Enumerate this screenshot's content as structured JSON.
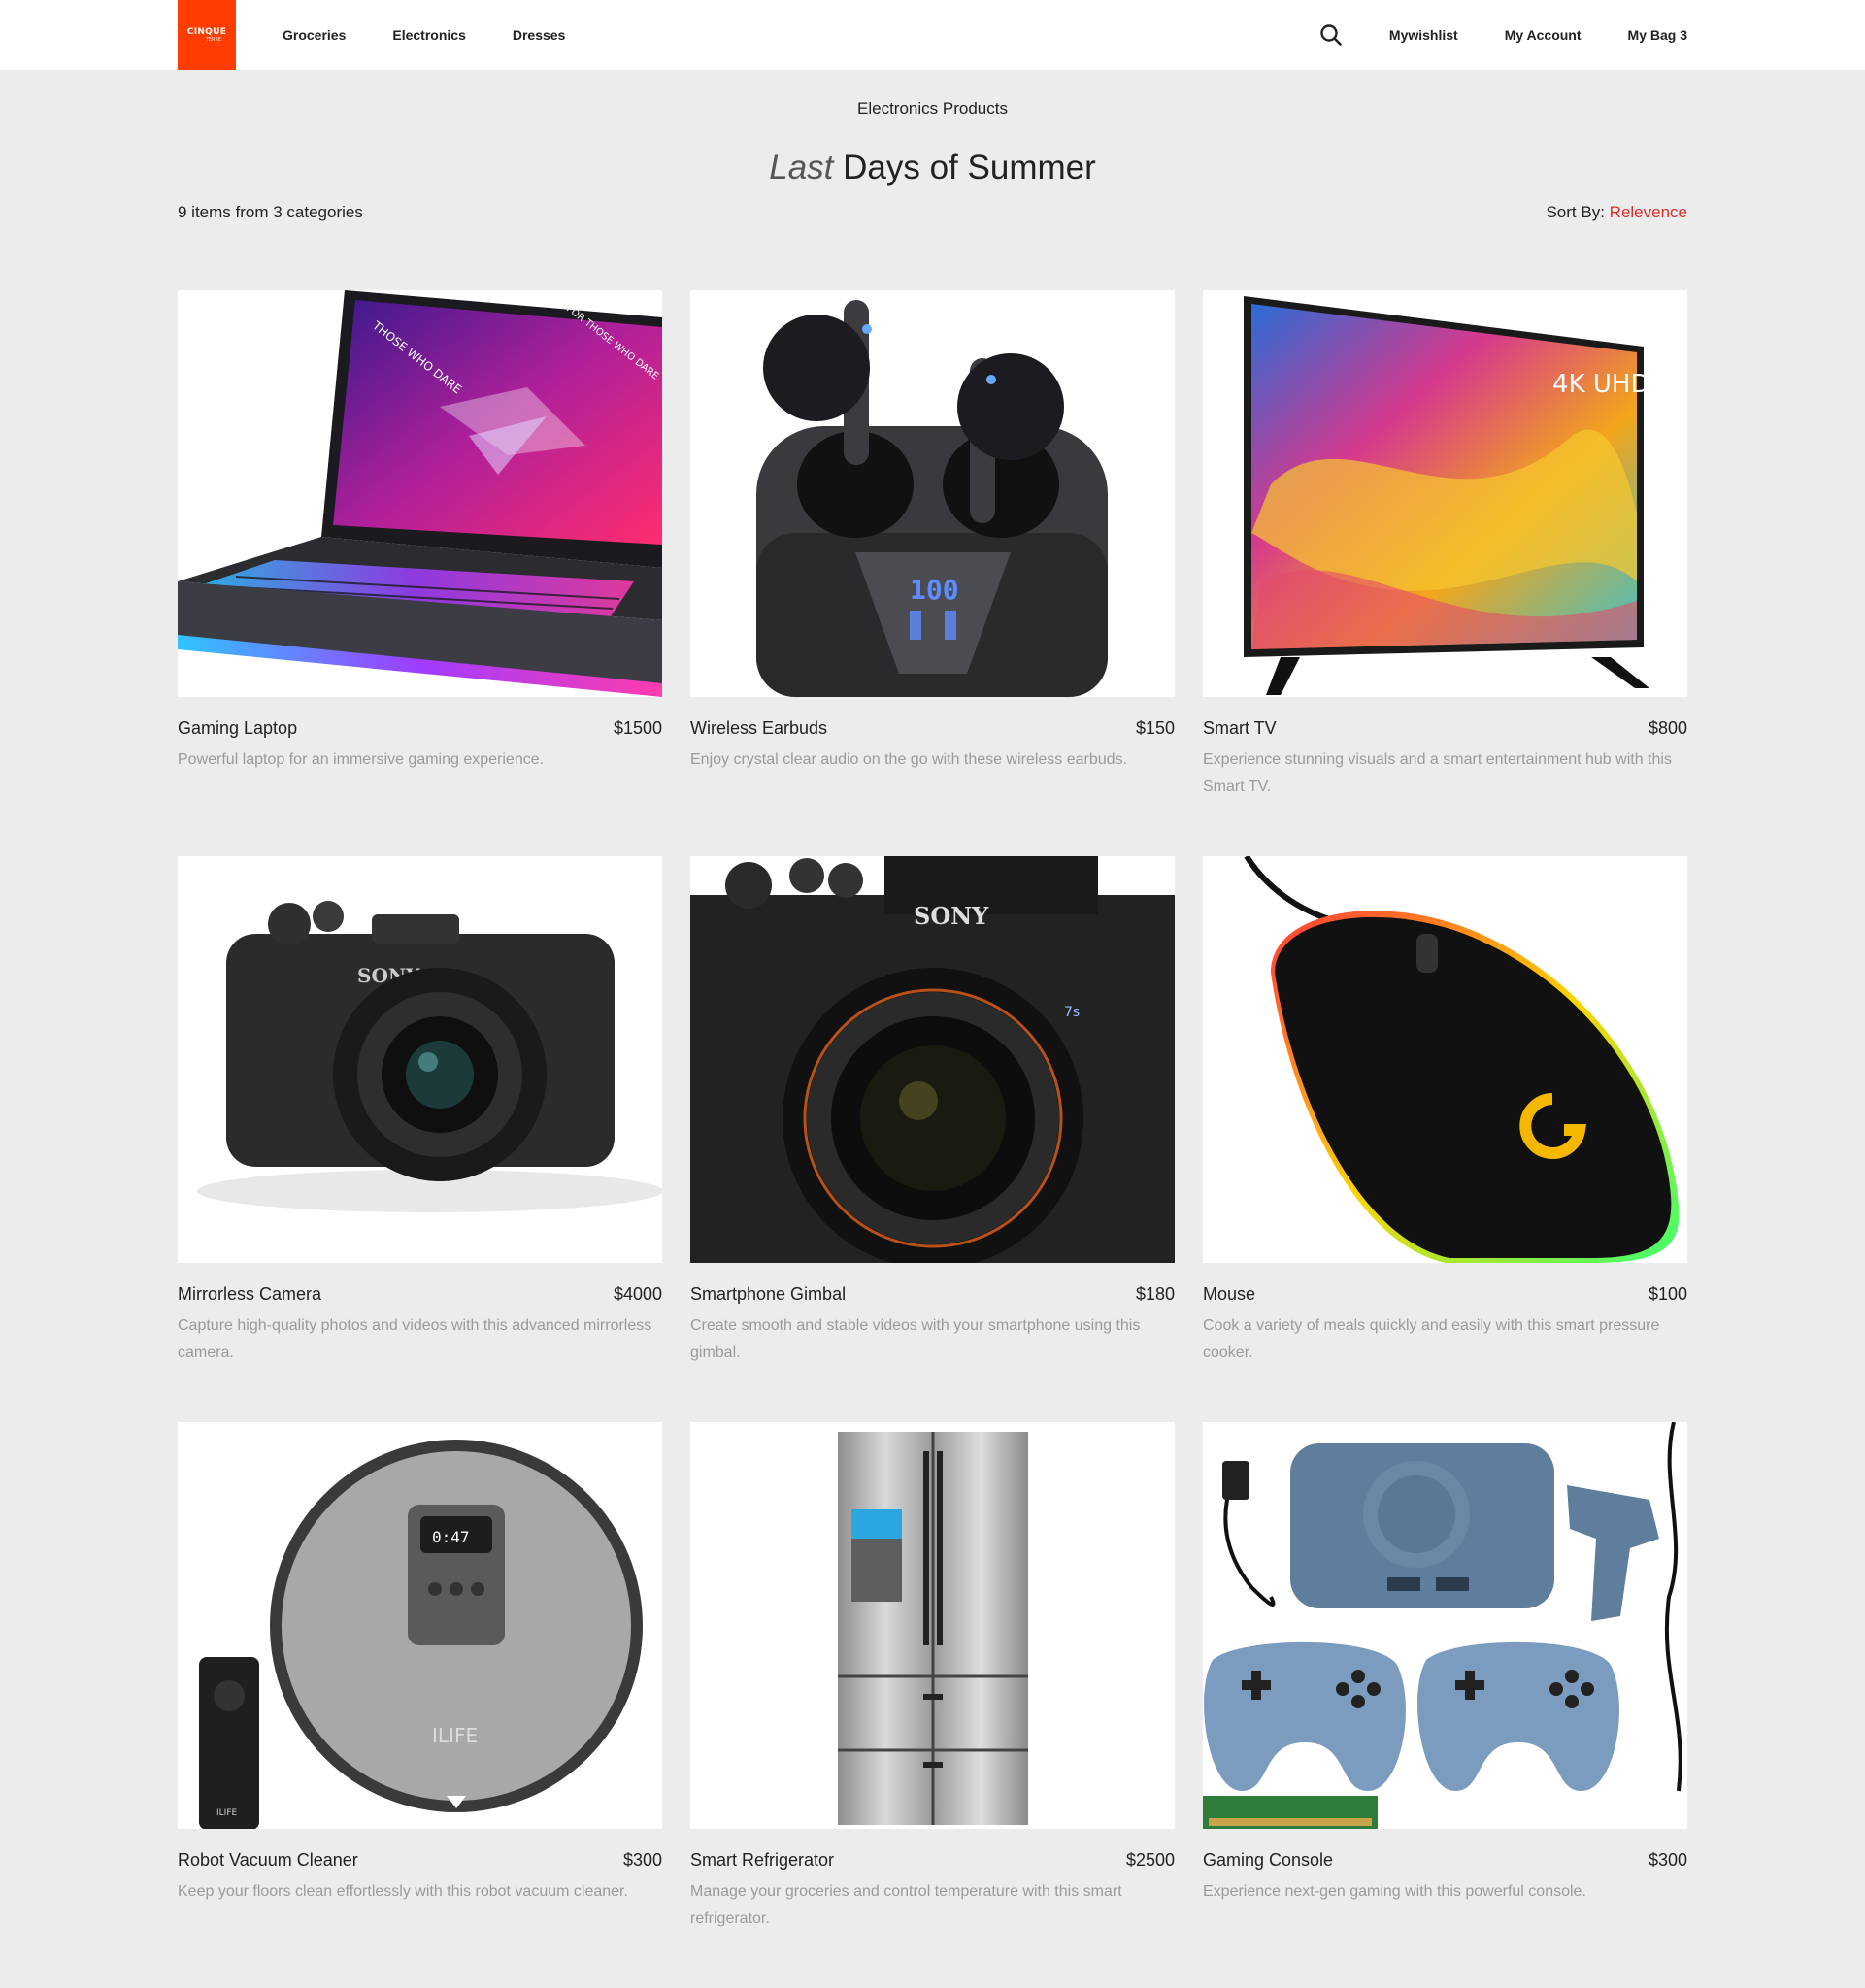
{
  "header": {
    "logo": {
      "line1": "CINQUE",
      "line2": "TERRE"
    },
    "nav_left": [
      "Groceries",
      "Electronics",
      "Dresses"
    ],
    "nav_right": [
      "Mywishlist",
      "My Account",
      "My Bag 3"
    ],
    "search_icon": "search-icon"
  },
  "page": {
    "section_label": "Electronics Products",
    "title_em": "Last",
    "title_rest": "Days of Summer",
    "count_text": "9 items from 3 categories",
    "sort_label": "Sort By:",
    "sort_value": "Relevence",
    "sort_color": "#d32f2f"
  },
  "colors": {
    "brand": "#ff3d00",
    "background": "#ececec"
  },
  "products": [
    {
      "name": "Gaming Laptop",
      "price": "$1500",
      "desc": "Powerful laptop for an immersive gaming experience.",
      "icon": "laptop-image"
    },
    {
      "name": "Wireless Earbuds",
      "price": "$150",
      "desc": "Enjoy crystal clear audio on the go with these wireless earbuds.",
      "icon": "earbuds-image"
    },
    {
      "name": "Smart TV",
      "price": "$800",
      "desc": "Experience stunning visuals and a smart entertainment hub with this Smart TV.",
      "icon": "tv-image"
    },
    {
      "name": "Mirrorless Camera",
      "price": "$4000",
      "desc": "Capture high-quality photos and videos with this advanced mirrorless camera.",
      "icon": "camera-image"
    },
    {
      "name": "Smartphone Gimbal",
      "price": "$180",
      "desc": "Create smooth and stable videos with your smartphone using this gimbal.",
      "icon": "camera-image"
    },
    {
      "name": "Mouse",
      "price": "$100",
      "desc": "Cook a variety of meals quickly and easily with this smart pressure cooker.",
      "icon": "mouse-image"
    },
    {
      "name": "Robot Vacuum Cleaner",
      "price": "$300",
      "desc": "Keep your floors clean effortlessly with this robot vacuum cleaner.",
      "icon": "vacuum-image"
    },
    {
      "name": "Smart Refrigerator",
      "price": "$2500",
      "desc": "Manage your groceries and control temperature with this smart refrigerator.",
      "icon": "refrigerator-image"
    },
    {
      "name": "Gaming Console",
      "price": "$300",
      "desc": "Experience next-gen gaming with this powerful console.",
      "icon": "console-image"
    }
  ],
  "image_text": {
    "laptop_screen": [
      "THOSE WHO DARE",
      "FOR THOSE WHO DARE"
    ],
    "earbuds_display": "100",
    "tv_badge": "4K UHD",
    "camera1_brand": "SONY",
    "camera2_brand": "SONY",
    "camera2_model": "7s",
    "vacuum_brand": "ILIFE",
    "vacuum_display": "0:47",
    "remote_brand": "ILIFE"
  }
}
